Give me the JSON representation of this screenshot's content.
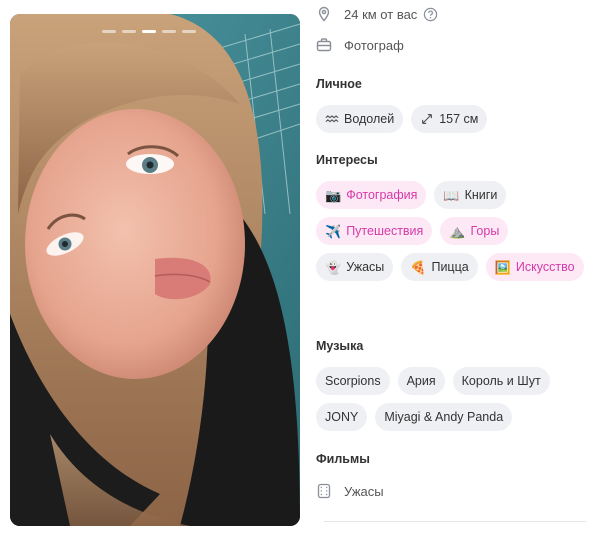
{
  "profile": {
    "distance": "24 км от вас",
    "job": "Фотограф"
  },
  "sections": {
    "personal": "Личное",
    "interests": "Интересы",
    "music": "Музыка",
    "movies": "Фильмы"
  },
  "personal": [
    {
      "icon": "aquarius-icon",
      "label": "Водолей"
    },
    {
      "icon": "height-arrows-icon",
      "label": "157 см"
    }
  ],
  "interests": [
    {
      "emoji": "📷",
      "label": "Фотография",
      "highlighted": true
    },
    {
      "emoji": "📖",
      "label": "Книги",
      "highlighted": false
    },
    {
      "emoji": "✈️",
      "label": "Путешествия",
      "highlighted": true
    },
    {
      "emoji": "⛰️",
      "label": "Горы",
      "highlighted": true
    },
    {
      "emoji": "👻",
      "label": "Ужасы",
      "highlighted": false
    },
    {
      "emoji": "🍕",
      "label": "Пицца",
      "highlighted": false
    },
    {
      "emoji": "🖼️",
      "label": "Искусство",
      "highlighted": true
    }
  ],
  "music": [
    "Scorpions",
    "Ария",
    "Король и Шут",
    "JONY",
    "Miyagi & Andy Panda"
  ],
  "movies": {
    "icon": "film-icon",
    "label": "Ужасы"
  },
  "photo": {
    "photo_index": 3,
    "photo_count": 5
  },
  "colors": {
    "highlight_bg": "#fde8f5",
    "highlight_text": "#d63aa8",
    "chip_bg": "#eef0f3"
  }
}
